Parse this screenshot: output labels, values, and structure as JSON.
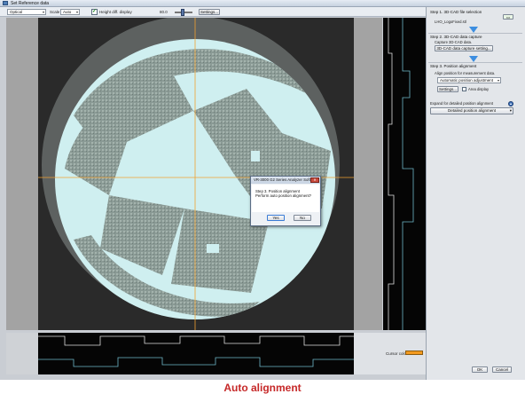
{
  "window": {
    "title": "Set Reference data"
  },
  "toolbar": {
    "view_combo": "Optical",
    "scale_label": "Scale",
    "scale_combo": "Auto",
    "height_diff_checked": "✓",
    "height_diff_label": "Height diff. display",
    "zoom_label": "80.0",
    "settings_label": "Settings..."
  },
  "side_panel": {
    "step1_title": "Step 1. 3D-CAD file selection",
    "step1_file": "LHO_LogoFixed.stl",
    "step2_title": "Step 2. 3D-CAD data capture",
    "step2_text": "Capture 3D-CAD data.",
    "step2_button": "3D-CAD data capture setting...",
    "step3_title": "Step 3. Position alignment",
    "step3_text": "Align position for measurement data.",
    "step3_combo": "Automatic position adjustment",
    "settings_button": "Settings...",
    "area_display_label": "Area display",
    "expand_label": "Expand for detailed position alignment",
    "detailed_button": "Detailed position alignment",
    "ok_button": "OK",
    "cancel_button": "Cancel",
    "arrow_color": "#3d8ee0"
  },
  "bottom": {
    "cursor_color_label": "Cursor color",
    "cursor_color": "#f39a1e"
  },
  "dialog": {
    "title": "VR-3000 G2 Series Analyzer Soft...",
    "close_icon": "close-icon",
    "line1": "Step 3. Position alignment",
    "line2": "Perform auto position alignment?",
    "yes_label": "Yes",
    "no_label": "No"
  },
  "caption": {
    "text": "Auto alignment",
    "color": "#c62828"
  }
}
